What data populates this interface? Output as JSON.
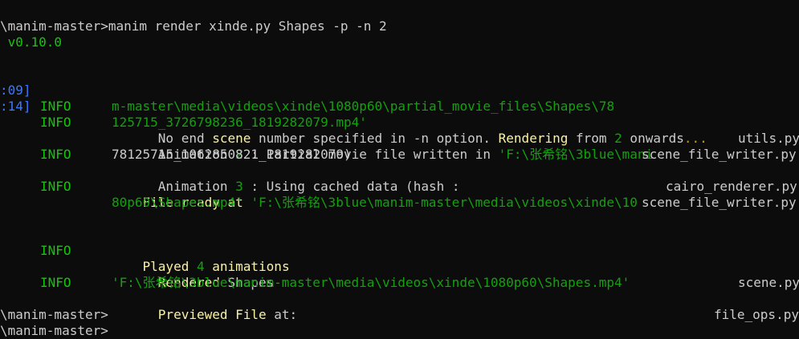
{
  "terminal": {
    "cut_top_text": "                      ░░    ░░░░      ░░░░░░ ░░        ░",
    "prompt_cmd": "\\manim-master>manim render xinde.py Shapes -p -n 2",
    "version": " v0.10.0",
    "log": [
      {
        "time": ":09]",
        "level": "INFO",
        "message_parts": [
          {
            "text": "No end ",
            "c": "white"
          },
          {
            "text": "scene",
            "c": "yellow"
          },
          {
            "text": " number specified in -n option. ",
            "c": "white"
          },
          {
            "text": "Rendering",
            "c": "yellow"
          },
          {
            "text": " from ",
            "c": "white"
          },
          {
            "text": "2",
            "c": "dgreen"
          },
          {
            "text": " onwards",
            "c": "white"
          },
          {
            "text": "...",
            "c": "olive"
          }
        ],
        "source": "utils.py"
      },
      {
        "time": ":14]",
        "level": "INFO",
        "message_line1_parts": [
          {
            "text": "Animation ",
            "c": "white"
          },
          {
            "text": "2",
            "c": "dgreen"
          },
          {
            "text": " : Partial movie file written in ",
            "c": "white"
          },
          {
            "text": "'F:\\张希铭\\3blue\\mani",
            "c": "dgreen"
          }
        ],
        "message_line2": "m-master\\media\\videos\\xinde\\1080p60\\partial_movie_files\\Shapes\\78",
        "message_line3": "125715_3726798236_1819282079.mp4'",
        "source": "scene_file_writer.py"
      },
      {
        "level": "INFO",
        "message_line1_parts": [
          {
            "text": "Animation ",
            "c": "white"
          },
          {
            "text": "3",
            "c": "dgreen"
          },
          {
            "text": " : Using cached data (hash :",
            "c": "white"
          }
        ],
        "message_line2": "78125715_1062850821_1819282079)",
        "source": "cairo_renderer.py"
      },
      {
        "level": "INFO",
        "source": "scene_file_writer.py",
        "message_line2_prefix": "File ready at ",
        "message_line2_path": "'F:\\张希铭\\3blue\\manim-master\\media\\videos\\xinde\\10",
        "message_line3": "80p60\\Shapes.mp4'"
      },
      {
        "level": "INFO",
        "message_line1_parts": [
          {
            "text": "Rendered",
            "c": "yellow"
          },
          {
            "text": " Shapes",
            "c": "white"
          }
        ],
        "message_line2_parts": [
          {
            "text": "Played ",
            "c": "yellow"
          },
          {
            "text": "4",
            "c": "dgreen"
          },
          {
            "text": " animations",
            "c": "yellow"
          }
        ],
        "source": "scene.py"
      },
      {
        "level": "INFO",
        "message_line1_parts": [
          {
            "text": "Previewed ",
            "c": "yellow"
          },
          {
            "text": "File",
            "c": "yellow"
          },
          {
            "text": " at:",
            "c": "white"
          }
        ],
        "message_line2": "'F:\\张希铭\\3blue\\manim-master\\media\\videos\\xinde\\1080p60\\Shapes.mp4'",
        "source": "file_ops.py"
      }
    ],
    "prompt_1": "\\manim-master>",
    "prompt_2": "\\manim-master>"
  }
}
